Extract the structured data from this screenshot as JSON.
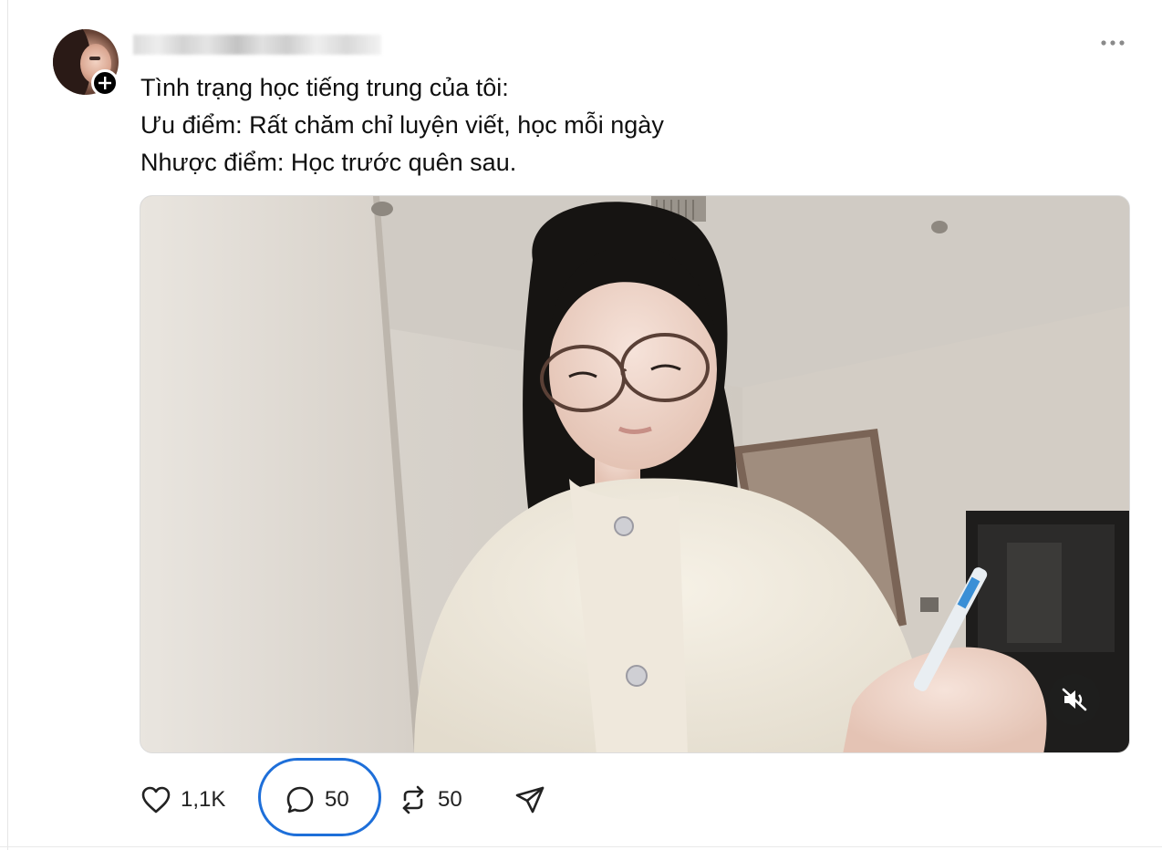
{
  "post": {
    "author_name": "",
    "text_lines": [
      "Tình trạng học tiếng trung của tôi:",
      "Ưu điểm: Rất chăm chỉ luyện viết, học mỗi ngày",
      "Nhược điểm: Học trước quên sau."
    ],
    "media": {
      "type": "video",
      "muted": true,
      "mute_icon": "speaker-muted-icon"
    }
  },
  "actions": {
    "like": {
      "icon": "heart-icon",
      "count": "1,1K"
    },
    "reply": {
      "icon": "comment-icon",
      "count": "50",
      "highlighted": true
    },
    "repost": {
      "icon": "repost-icon",
      "count": "50"
    },
    "share": {
      "icon": "send-icon"
    }
  },
  "colors": {
    "highlight_ring": "#1e6fd9",
    "text": "#0f0f0f",
    "icon": "#222222"
  }
}
